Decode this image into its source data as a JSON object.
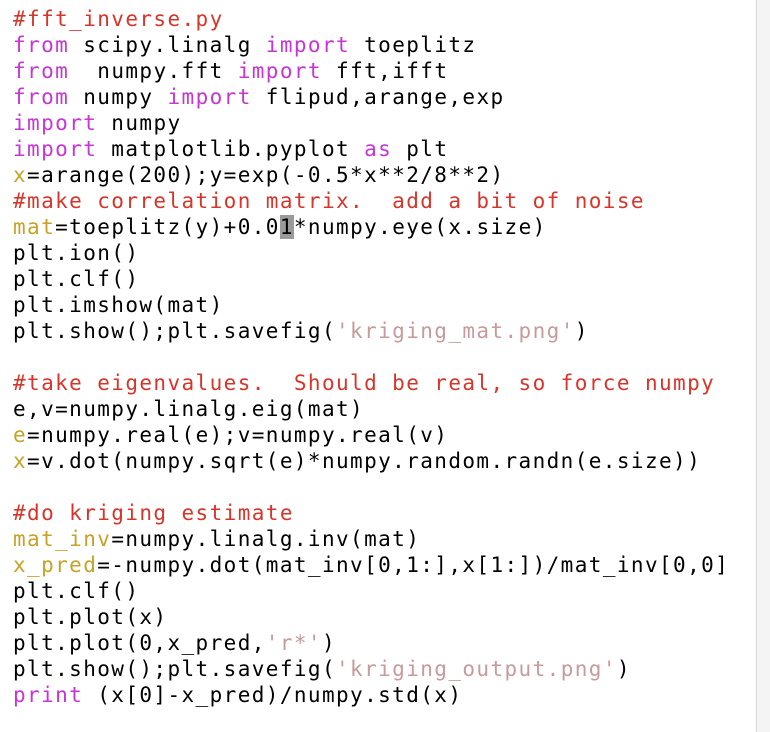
{
  "editor": {
    "lines": [
      [
        {
          "t": "#fft_inverse.py",
          "k": "comment"
        }
      ],
      [
        {
          "t": "from",
          "k": "keyword"
        },
        {
          "t": " scipy.linalg ",
          "k": "plain"
        },
        {
          "t": "import",
          "k": "keyword"
        },
        {
          "t": " toeplitz",
          "k": "plain"
        }
      ],
      [
        {
          "t": "from",
          "k": "keyword"
        },
        {
          "t": "  numpy.fft ",
          "k": "plain"
        },
        {
          "t": "import",
          "k": "keyword"
        },
        {
          "t": " fft,ifft",
          "k": "plain"
        }
      ],
      [
        {
          "t": "from",
          "k": "keyword"
        },
        {
          "t": " numpy ",
          "k": "plain"
        },
        {
          "t": "import",
          "k": "keyword"
        },
        {
          "t": " flipud,arange,exp",
          "k": "plain"
        }
      ],
      [
        {
          "t": "import",
          "k": "keyword"
        },
        {
          "t": " numpy",
          "k": "plain"
        }
      ],
      [
        {
          "t": "import",
          "k": "keyword"
        },
        {
          "t": " matplotlib.pyplot ",
          "k": "plain"
        },
        {
          "t": "as",
          "k": "keyword"
        },
        {
          "t": " plt",
          "k": "plain"
        }
      ],
      [
        {
          "t": "x",
          "k": "var"
        },
        {
          "t": "=arange(200);y=exp(-0.5*x**2/8**2)",
          "k": "plain"
        }
      ],
      [
        {
          "t": "#make correlation matrix.  add a bit of noise",
          "k": "comment"
        }
      ],
      [
        {
          "t": "mat",
          "k": "var"
        },
        {
          "t": "=toeplitz(y)+0.0",
          "k": "plain"
        },
        {
          "t": "1",
          "k": "cursor"
        },
        {
          "t": "*numpy.eye(x.size)",
          "k": "plain"
        }
      ],
      [
        {
          "t": "plt.ion()",
          "k": "plain"
        }
      ],
      [
        {
          "t": "plt.clf()",
          "k": "plain"
        }
      ],
      [
        {
          "t": "plt.imshow(mat)",
          "k": "plain"
        }
      ],
      [
        {
          "t": "plt.show();plt.savefig(",
          "k": "plain"
        },
        {
          "t": "'kriging_mat.png'",
          "k": "string"
        },
        {
          "t": ")",
          "k": "plain"
        }
      ],
      [],
      [
        {
          "t": "#take eigenvalues.  Should be real, so force numpy",
          "k": "comment"
        }
      ],
      [
        {
          "t": "e,v=numpy.linalg.eig(mat)",
          "k": "plain"
        }
      ],
      [
        {
          "t": "e",
          "k": "var"
        },
        {
          "t": "=numpy.real(e);v=numpy.real(v)",
          "k": "plain"
        }
      ],
      [
        {
          "t": "x",
          "k": "var"
        },
        {
          "t": "=v.dot(numpy.sqrt(e)*numpy.random.randn(e.size))",
          "k": "plain"
        }
      ],
      [],
      [
        {
          "t": "#do kriging estimate",
          "k": "comment"
        }
      ],
      [
        {
          "t": "mat_inv",
          "k": "var"
        },
        {
          "t": "=numpy.linalg.inv(mat)",
          "k": "plain"
        }
      ],
      [
        {
          "t": "x_pred",
          "k": "var"
        },
        {
          "t": "=-numpy.dot(mat_inv[0,1:],x[1:])/mat_inv[0,0]",
          "k": "plain"
        }
      ],
      [
        {
          "t": "plt.clf()",
          "k": "plain"
        }
      ],
      [
        {
          "t": "plt.plot(x)",
          "k": "plain"
        }
      ],
      [
        {
          "t": "plt.plot(0,x_pred,",
          "k": "plain"
        },
        {
          "t": "'r*'",
          "k": "string"
        },
        {
          "t": ")",
          "k": "plain"
        }
      ],
      [
        {
          "t": "plt.show();plt.savefig(",
          "k": "plain"
        },
        {
          "t": "'kriging_output.png'",
          "k": "string"
        },
        {
          "t": ")",
          "k": "plain"
        }
      ],
      [
        {
          "t": "print",
          "k": "keyword"
        },
        {
          "t": " (x[0]-x_pred)/numpy.std(x)",
          "k": "plain"
        }
      ]
    ]
  },
  "colors": {
    "background": "#ffffff",
    "text": "#000000",
    "comment": "#d8352a",
    "keyword": "#c735d6",
    "variable": "#c7a227",
    "string": "#c79b9b",
    "cursor": "#9a9a9a"
  }
}
